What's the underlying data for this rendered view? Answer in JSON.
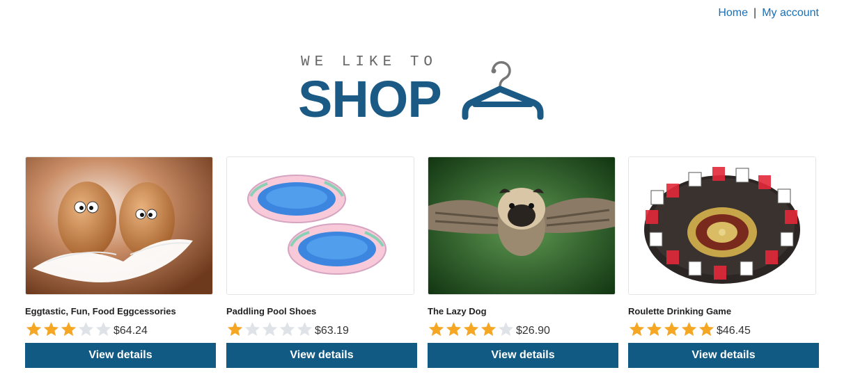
{
  "nav": {
    "home_label": "Home",
    "separator": "|",
    "account_label": "My account"
  },
  "logo": {
    "tagline": "WE LIKE TO",
    "wordmark": "SHOP",
    "icon": "hanger-icon"
  },
  "colors": {
    "brand": "#105a84",
    "link": "#1a6fb5",
    "star_filled": "#f5a623",
    "star_empty": "#dfe3e8"
  },
  "products": [
    {
      "title": "Eggtastic, Fun, Food Eggcessories",
      "rating": 3,
      "max_rating": 5,
      "price": "$64.24",
      "button_label": "View details",
      "image": "eggs-with-feathers"
    },
    {
      "title": "Paddling Pool Shoes",
      "rating": 1,
      "max_rating": 5,
      "price": "$63.19",
      "button_label": "View details",
      "image": "inflatable-pool-shoes"
    },
    {
      "title": "The Lazy Dog",
      "rating": 4,
      "max_rating": 5,
      "price": "$26.90",
      "button_label": "View details",
      "image": "pug-with-owl-wings"
    },
    {
      "title": "Roulette Drinking Game",
      "rating": 5,
      "max_rating": 5,
      "price": "$46.45",
      "button_label": "View details",
      "image": "roulette-shot-glass-wheel"
    }
  ]
}
